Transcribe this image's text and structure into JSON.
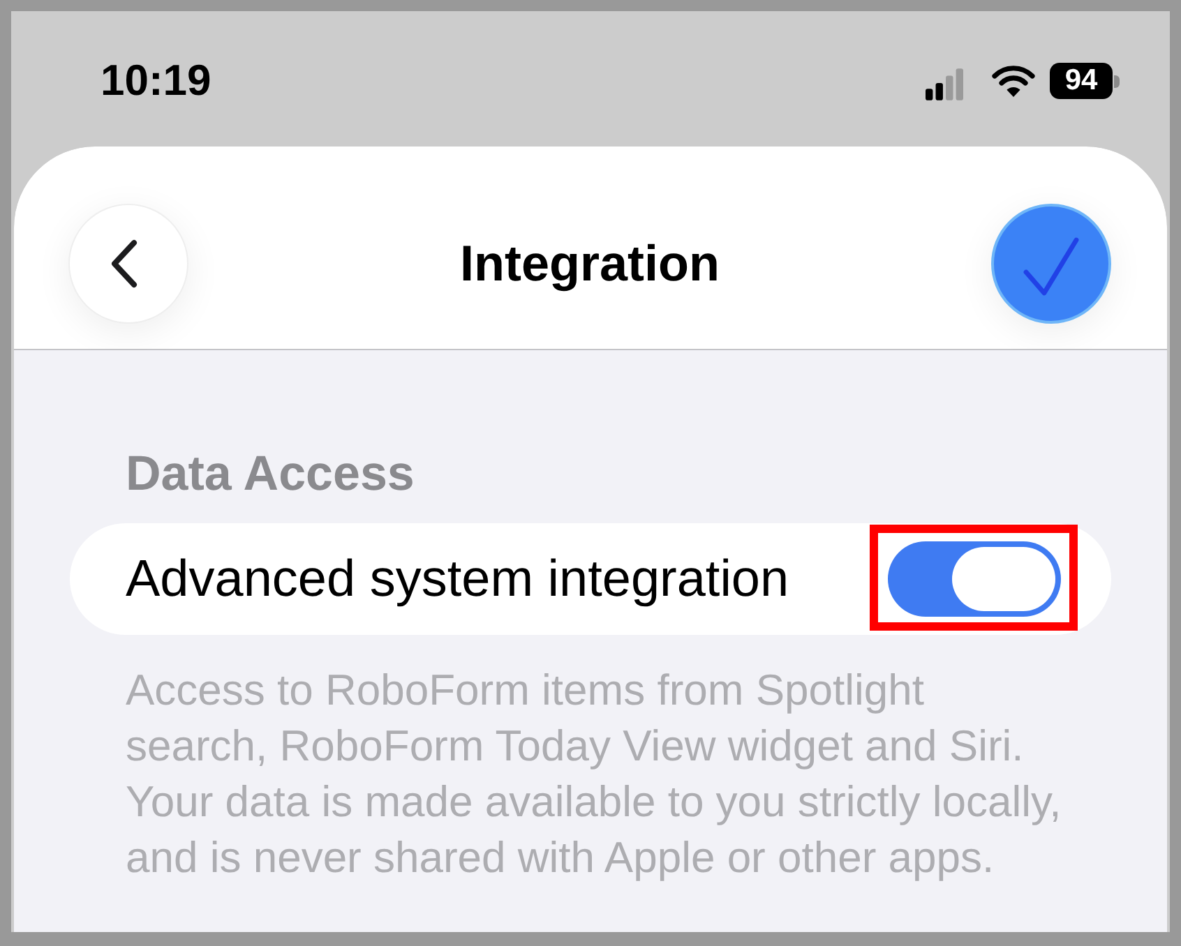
{
  "status_bar": {
    "time": "10:19",
    "battery": "94"
  },
  "header": {
    "title": "Integration"
  },
  "section": {
    "title": "Data Access",
    "rows": [
      {
        "kind": "toggle",
        "label": "Advanced system integration",
        "on": true,
        "highlighted": true
      }
    ],
    "footer_lines": [
      "Access to RoboForm items from Spotlight",
      "search, RoboForm Today View widget and Siri.",
      "Your data is made available to you strictly locally,",
      "and is never shared with Apple or other apps."
    ]
  }
}
